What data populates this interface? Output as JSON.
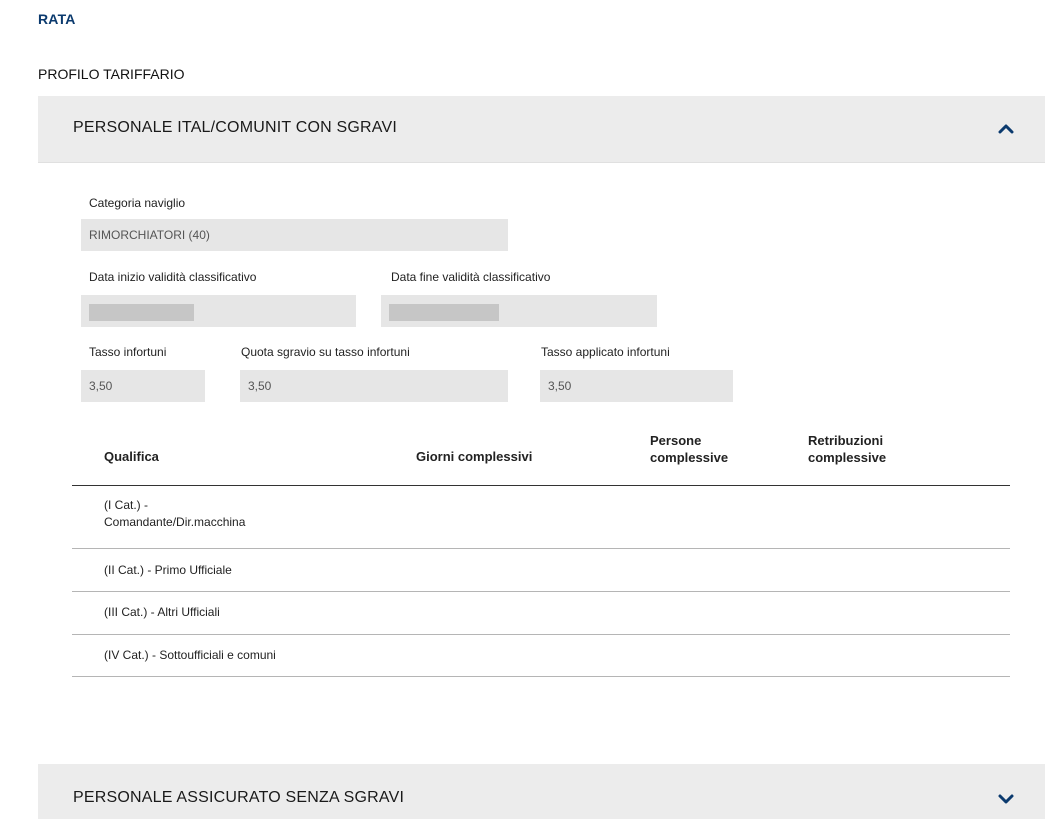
{
  "header": {
    "rata": "RATA",
    "profilo": "PROFILO TARIFFARIO"
  },
  "accordion1": {
    "title": "PERSONALE ITAL/COMUNIT CON SGRAVI",
    "expanded": true,
    "chevron_icon": "chevron-up-icon",
    "fields": {
      "categoria": {
        "label": "Categoria naviglio",
        "value": "RIMORCHIATORI (40)"
      },
      "data_inizio": {
        "label": "Data inizio validità classificativo",
        "value": ""
      },
      "data_fine": {
        "label": "Data fine validità classificativo",
        "value": ""
      },
      "tasso_infortuni": {
        "label": "Tasso infortuni",
        "value": "3,50"
      },
      "quota_sgravio": {
        "label": "Quota sgravio su tasso infortuni",
        "value": "3,50"
      },
      "tasso_applicato": {
        "label": "Tasso applicato infortuni",
        "value": "3,50"
      }
    },
    "table": {
      "headers": [
        "Qualifica",
        "Giorni complessivi",
        "Persone\ncomplessive",
        "Retribuzioni\ncomplessive"
      ],
      "rows": [
        {
          "qualifica": "(I Cat.) -\nComandante/Dir.macchina"
        },
        {
          "qualifica": "(II Cat.) - Primo Ufficiale"
        },
        {
          "qualifica": "(III Cat.) - Altri Ufficiali"
        },
        {
          "qualifica": "(IV Cat.) - Sottoufficiali e comuni"
        }
      ]
    }
  },
  "accordion2": {
    "title": "PERSONALE ASSICURATO SENZA SGRAVI",
    "expanded": false,
    "chevron_icon": "chevron-down-icon"
  },
  "colors": {
    "link_blue": "#0b3a6e",
    "header_bg": "#ececec",
    "field_bg": "#e6e6e6"
  }
}
